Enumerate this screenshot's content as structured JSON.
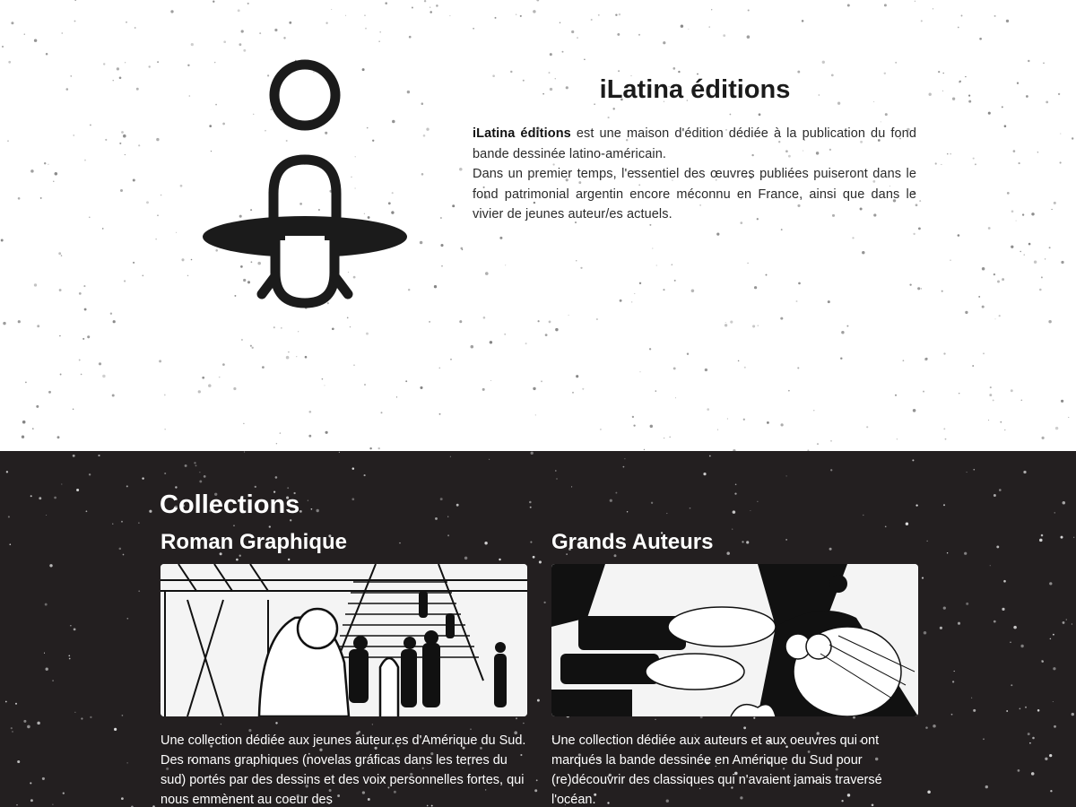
{
  "about": {
    "title": "iLatina éditions",
    "intro_brand": "iLatina éditions",
    "intro_line1_rest": " est une maison d'édition dédiée à la publication du fond bande dessinée latino-américain.",
    "intro_line2": "Dans un premier temps, l'essentiel des œuvres publiées puiseront dans le fond patrimonial argentin encore méconnu en France, ainsi que dans le vivier de jeunes auteur/es actuels."
  },
  "collections": {
    "heading": "Collections",
    "items": [
      {
        "title": "Roman Graphique",
        "image_icon": "comic-panel-crowd-stairs",
        "text": "Une collection dédiée aux jeunes auteur.es d'Amérique du Sud. Des romans graphiques (novelas gráficas dans les terres du sud) portés par des dessins et des voix personnelles fortes, qui nous emmènent au coeur des"
      },
      {
        "title": "Grands Auteurs",
        "image_icon": "comic-panel-gunfire",
        "text": "Une collection dédiée aux auteurs et aux oeuvres qui ont marqués la bande dessinée en Amérique du Sud pour (re)découvrir des classiques qui n'avaient jamais traversé l'océan."
      }
    ]
  },
  "colors": {
    "light_bg": "#ffffff",
    "dark_bg": "#231f20",
    "ink": "#1b1b1b",
    "light_text": "#ffffff"
  }
}
